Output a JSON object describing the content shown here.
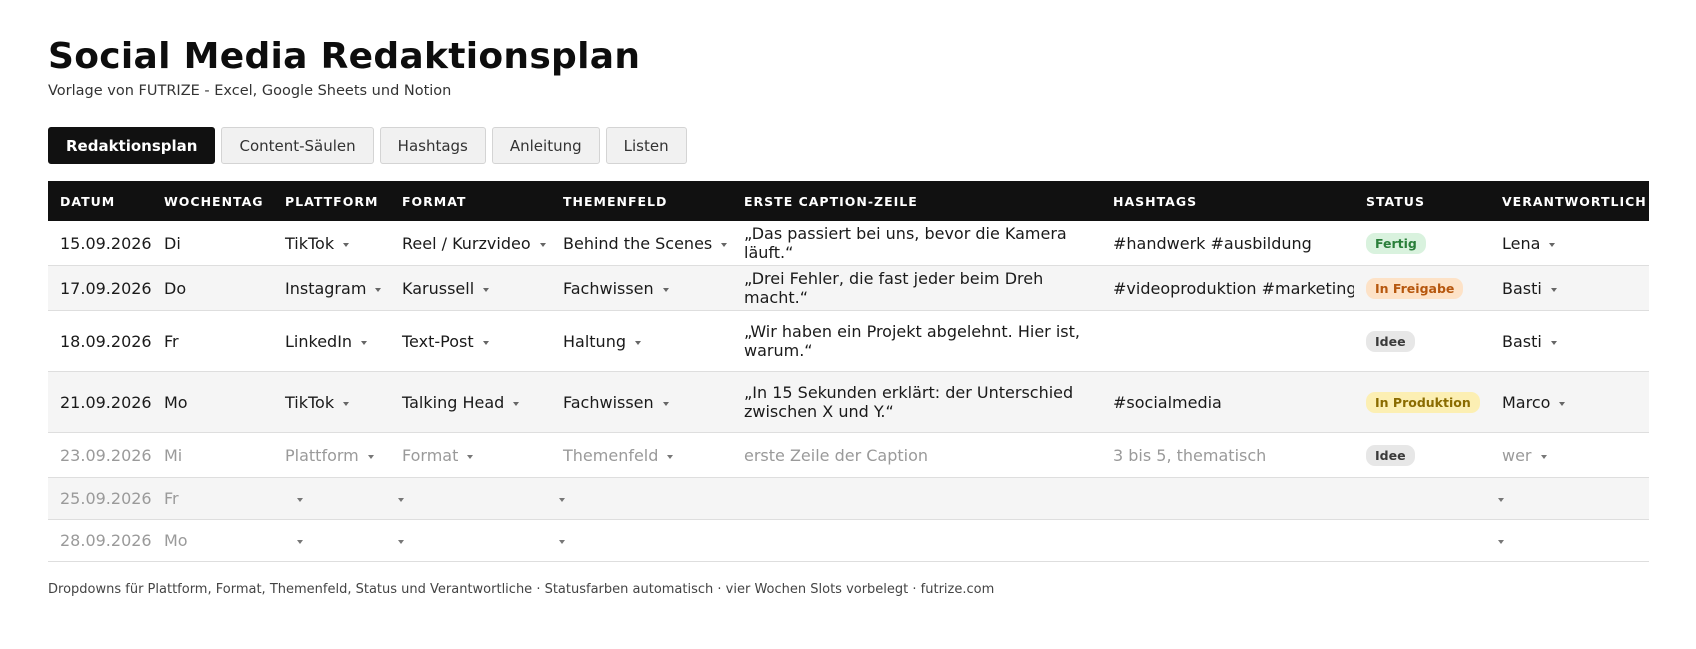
{
  "page": {
    "title": "Social Media Redaktionsplan",
    "subtitle": "Vorlage von FUTRIZE - Excel, Google Sheets und Notion"
  },
  "tabs": [
    "Redaktionsplan",
    "Content-Säulen",
    "Hashtags",
    "Anleitung",
    "Listen"
  ],
  "active_tab": "Redaktionsplan",
  "table": {
    "columns": [
      "DATUM",
      "WOCHENTAG",
      "PLATTFORM",
      "FORMAT",
      "THEMENFELD",
      "ERSTE CAPTION-ZEILE",
      "HASHTAGS",
      "STATUS",
      "VERANTWORTLICH"
    ],
    "rows": [
      {
        "datum": "15.09.2026",
        "wochentag": "Di",
        "plattform": "TikTok",
        "format": "Reel / Kurzvideo",
        "themenfeld": "Behind the Scenes",
        "caption": "„Das passiert bei uns, bevor die Kamera läuft.“",
        "hashtags": "#handwerk #ausbildung",
        "status": "Fertig",
        "verantwortlich": "Lena"
      },
      {
        "datum": "17.09.2026",
        "wochentag": "Do",
        "plattform": "Instagram",
        "format": "Karussell",
        "themenfeld": "Fachwissen",
        "caption": "„Drei Fehler, die fast jeder beim Dreh macht.“",
        "hashtags": "#videoproduktion #marketing",
        "status": "In Freigabe",
        "verantwortlich": "Basti"
      },
      {
        "datum": "18.09.2026",
        "wochentag": "Fr",
        "plattform": "LinkedIn",
        "format": "Text-Post",
        "themenfeld": "Haltung",
        "caption": "„Wir haben ein Projekt abgelehnt. Hier ist, warum.“",
        "hashtags": "",
        "status": "Idee",
        "verantwortlich": "Basti"
      },
      {
        "datum": "21.09.2026",
        "wochentag": "Mo",
        "plattform": "TikTok",
        "format": "Talking Head",
        "themenfeld": "Fachwissen",
        "caption": "„In 15 Sekunden erklärt: der Unterschied zwischen X und Y.“",
        "hashtags": "#socialmedia",
        "status": "In Produktion",
        "verantwortlich": "Marco"
      },
      {
        "datum": "23.09.2026",
        "wochentag": "Mi",
        "plattform": "Plattform",
        "format": "Format",
        "themenfeld": "Themenfeld",
        "caption": "erste Zeile der Caption",
        "hashtags": "3 bis 5, thematisch",
        "status": "Idee",
        "verantwortlich": "wer"
      },
      {
        "datum": "25.09.2026",
        "wochentag": "Fr",
        "plattform": "",
        "format": "",
        "themenfeld": "",
        "caption": "",
        "hashtags": "",
        "status": "",
        "verantwortlich": ""
      },
      {
        "datum": "28.09.2026",
        "wochentag": "Mo",
        "plattform": "",
        "format": "",
        "themenfeld": "",
        "caption": "",
        "hashtags": "",
        "status": "",
        "verantwortlich": ""
      }
    ]
  },
  "status_colors": {
    "Fertig": "#2a7f3a",
    "In Freigabe": "#b6570e",
    "Idee": "#3a3a3a",
    "In Produktion": "#8a6b00"
  },
  "footer": "Dropdowns für Plattform, Format, Themenfeld, Status und Verantwortliche · Statusfarben automatisch · vier Wochen Slots vorbelegt · futrize.com"
}
